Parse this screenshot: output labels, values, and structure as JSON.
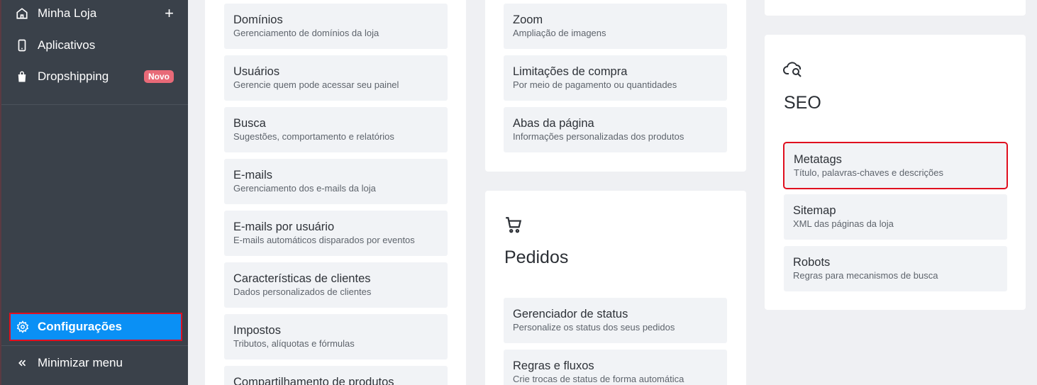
{
  "sidebar": {
    "items": [
      {
        "label": "Minha Loja",
        "icon": "home-icon"
      },
      {
        "label": "Aplicativos",
        "icon": "phone-icon"
      },
      {
        "label": "Dropshipping",
        "icon": "bag-icon",
        "badge": "Novo"
      }
    ],
    "settings_label": "Configurações",
    "minimize_label": "Minimizar menu"
  },
  "col1": {
    "cards": [
      {
        "title": "Domínios",
        "subtitle": "Gerenciamento de domínios da loja"
      },
      {
        "title": "Usuários",
        "subtitle": "Gerencie quem pode acessar seu painel"
      },
      {
        "title": "Busca",
        "subtitle": "Sugestões, comportamento e relatórios"
      },
      {
        "title": "E-mails",
        "subtitle": "Gerenciamento dos e-mails da loja"
      },
      {
        "title": "E-mails por usuário",
        "subtitle": "E-mails automáticos disparados por eventos"
      },
      {
        "title": "Características de clientes",
        "subtitle": "Dados personalizados de clientes"
      },
      {
        "title": "Impostos",
        "subtitle": "Tributos, alíquotas e fórmulas"
      },
      {
        "title": "Compartilhamento de produtos",
        "subtitle": ""
      }
    ]
  },
  "col2": {
    "cards": [
      {
        "title": "Zoom",
        "subtitle": "Ampliação de imagens"
      },
      {
        "title": "Limitações de compra",
        "subtitle": "Por meio de pagamento ou quantidades"
      },
      {
        "title": "Abas da página",
        "subtitle": "Informações personalizadas dos produtos"
      }
    ],
    "orders": {
      "title": "Pedidos",
      "cards": [
        {
          "title": "Gerenciador de status",
          "subtitle": "Personalize os status dos seus pedidos"
        },
        {
          "title": "Regras e fluxos",
          "subtitle": "Crie trocas de status de forma automática"
        }
      ]
    }
  },
  "seo": {
    "title": "SEO",
    "cards": [
      {
        "title": "Metatags",
        "subtitle": "Título, palavras-chaves e descrições"
      },
      {
        "title": "Sitemap",
        "subtitle": "XML das páginas da loja"
      },
      {
        "title": "Robots",
        "subtitle": "Regras para mecanismos de busca"
      }
    ]
  },
  "colors": {
    "sidebar": "#3a414a",
    "accent": "#0a90f5",
    "highlight": "#e00f1f",
    "badge": "#e86a78"
  }
}
